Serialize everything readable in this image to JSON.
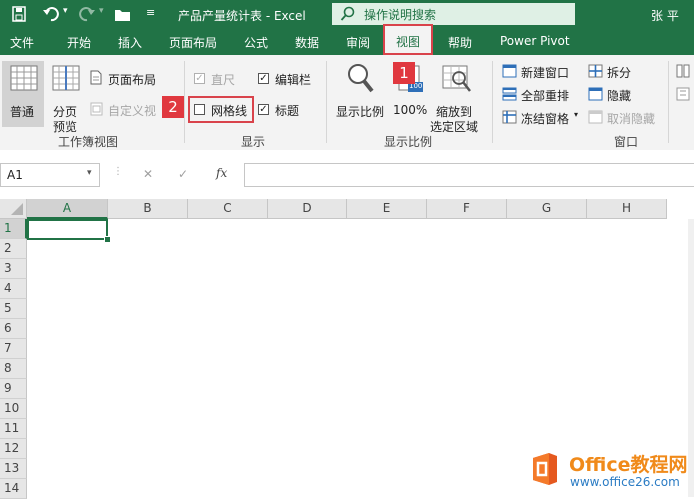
{
  "titlebar": {
    "doc_title": "产品产量统计表 - Excel",
    "search_placeholder": "操作说明搜索",
    "user": "张 平"
  },
  "tabs": [
    "文件",
    "开始",
    "插入",
    "页面布局",
    "公式",
    "数据",
    "审阅",
    "视图",
    "帮助",
    "Power Pivot"
  ],
  "ribbon": {
    "workbook_views": {
      "normal": "普通",
      "page_break_1": "分页",
      "page_break_2": "预览",
      "page_layout": "页面布局",
      "custom_views": "自定义视",
      "group_label": "工作簿视图"
    },
    "show": {
      "ruler": "直尺",
      "formula_bar": "编辑栏",
      "gridlines": "网格线",
      "headings": "标题",
      "group_label": "显示",
      "ruler_checked": true,
      "formula_bar_checked": true,
      "gridlines_checked": false,
      "headings_checked": true
    },
    "zoom": {
      "zoom": "显示比例",
      "hundred": "100%",
      "zoom_sel_1": "缩放到",
      "zoom_sel_2": "选定区域",
      "group_label": "显示比例",
      "icon_text": "100"
    },
    "window": {
      "new_window": "新建窗口",
      "arrange_all": "全部重排",
      "freeze_panes": "冻结窗格",
      "split": "拆分",
      "hide": "隐藏",
      "unhide": "取消隐藏",
      "group_label": "窗口"
    }
  },
  "annotations": {
    "badge1": "1",
    "badge2": "2"
  },
  "formula_bar": {
    "name_box": "A1",
    "cancel": "✕",
    "enter": "✓",
    "fx": "fx",
    "value": ""
  },
  "grid": {
    "columns": [
      "A",
      "B",
      "C",
      "D",
      "E",
      "F",
      "G",
      "H"
    ],
    "rows": [
      "1",
      "2",
      "3",
      "4",
      "5",
      "6",
      "7",
      "8",
      "9",
      "10",
      "11",
      "12",
      "13",
      "14"
    ],
    "selected_cell": "A1"
  },
  "watermark": {
    "title": "Office教程网",
    "url": "www.office26.com"
  },
  "colors": {
    "excel_green": "#217346",
    "highlight_red": "#d9434b",
    "badge_red": "#e0383f"
  }
}
